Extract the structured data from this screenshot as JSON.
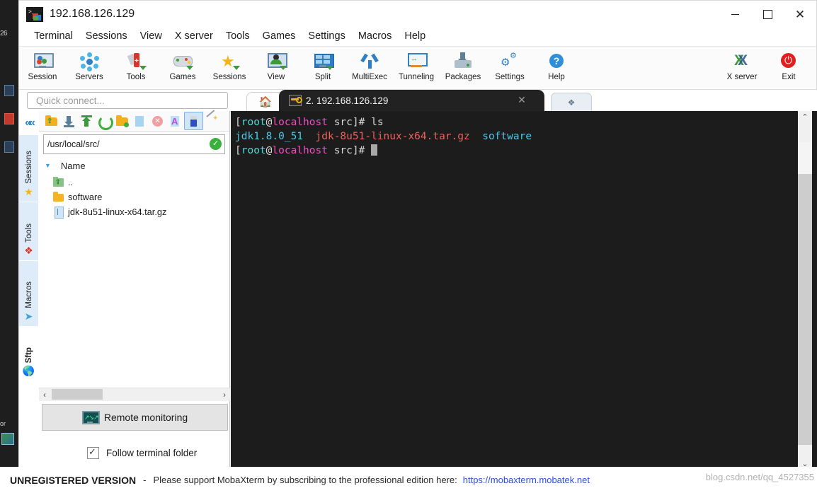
{
  "window": {
    "title": "192.168.126.129",
    "app_icon": "mobaxterm-icon",
    "minimize_label": "Minimize",
    "maximize_label": "Maximize",
    "close_label": "Close"
  },
  "background_label": "26",
  "background_tiny_label": "or",
  "menubar": [
    {
      "label": "Terminal"
    },
    {
      "label": "Sessions"
    },
    {
      "label": "View"
    },
    {
      "label": "X server"
    },
    {
      "label": "Tools"
    },
    {
      "label": "Games"
    },
    {
      "label": "Settings"
    },
    {
      "label": "Macros"
    },
    {
      "label": "Help"
    }
  ],
  "toolbar": {
    "items": [
      {
        "label": "Session",
        "icon": "session-monitor-icon"
      },
      {
        "label": "Servers",
        "icon": "servers-network-icon"
      },
      {
        "label": "Tools",
        "icon": "tools-knife-icon"
      },
      {
        "label": "Games",
        "icon": "games-gamepad-icon"
      },
      {
        "label": "Sessions",
        "icon": "sessions-star-icon"
      },
      {
        "label": "View",
        "icon": "view-user-monitor-icon"
      },
      {
        "label": "Split",
        "icon": "split-grid-icon"
      },
      {
        "label": "MultiExec",
        "icon": "multiexec-fork-icon"
      },
      {
        "label": "Tunneling",
        "icon": "tunneling-monitor-icon"
      },
      {
        "label": "Packages",
        "icon": "packages-download-icon"
      },
      {
        "label": "Settings",
        "icon": "settings-gear-icon"
      },
      {
        "label": "Help",
        "icon": "help-question-icon"
      }
    ],
    "right_items": [
      {
        "label": "X server",
        "icon": "xserver-x-icon"
      },
      {
        "label": "Exit",
        "icon": "exit-power-icon"
      }
    ]
  },
  "quick_connect": {
    "placeholder": "Quick connect...",
    "value": "",
    "clip_icon": "paperclip-icon"
  },
  "tabs": {
    "home_icon": "home-icon",
    "new_tab_label": "❖",
    "items": [
      {
        "label": "2. 192.168.126.129",
        "icon": "key-icon",
        "active": true,
        "close_label": "✕"
      }
    ]
  },
  "vertical_strip": {
    "collapse_label": "««",
    "tabs": [
      {
        "label": "Sessions",
        "icon": "star-icon",
        "glyph": "★",
        "color": "#f5b315",
        "active": false
      },
      {
        "label": "Tools",
        "icon": "knife-icon",
        "glyph": "⚘",
        "color": "#d8362a",
        "active": false
      },
      {
        "label": "Macros",
        "icon": "paper-plane-icon",
        "glyph": "➤",
        "color": "#3f9fd8",
        "active": false
      },
      {
        "label": "Sftp",
        "icon": "globe-icon",
        "glyph": "●",
        "color": "#f0a020",
        "active": true
      }
    ]
  },
  "sftp": {
    "toolbar_buttons": [
      {
        "name": "parent-folder-icon",
        "selected": false
      },
      {
        "name": "download-icon",
        "selected": false
      },
      {
        "name": "upload-icon",
        "selected": false
      },
      {
        "name": "refresh-icon",
        "selected": false
      },
      {
        "name": "new-folder-icon",
        "selected": false
      },
      {
        "name": "new-file-icon",
        "selected": false
      },
      {
        "name": "delete-icon",
        "selected": false
      },
      {
        "name": "text-editor-icon",
        "selected": false
      },
      {
        "name": "usb-drive-icon",
        "selected": true
      },
      {
        "name": "magic-wand-icon",
        "selected": false
      }
    ],
    "path": "/usr/local/src/",
    "path_ok_icon": "check-circle-icon",
    "column_header": "Name",
    "sort_caret": "▼",
    "files": [
      {
        "name": "..",
        "icon": "parent-dir-icon"
      },
      {
        "name": "software",
        "icon": "folder-icon"
      },
      {
        "name": "jdk-8u51-linux-x64.tar.gz",
        "icon": "file-icon"
      }
    ],
    "hscroll": {
      "left_arrow": "‹",
      "right_arrow": "›"
    },
    "remote_monitoring": {
      "label": "Remote monitoring",
      "icon": "monitor-graph-icon"
    },
    "follow_terminal": {
      "label": "Follow terminal folder",
      "checked": true
    }
  },
  "terminal": {
    "colors": {
      "background": "#1c1c1c",
      "user": "#4fd8d8",
      "host": "#f04fc4",
      "text": "#d8d8d8",
      "directory": "#4fc8e8",
      "archive": "#f0605c"
    },
    "lines": [
      {
        "type": "prompt_command",
        "bracket_open": "[",
        "user": "root",
        "at": "@",
        "host": "localhost",
        "path": " src",
        "bracket_close": "]# ",
        "command": "ls"
      },
      {
        "type": "output",
        "entries": [
          {
            "text": "jdk1.8.0_51",
            "kind": "directory"
          },
          {
            "text": "  ",
            "kind": "space"
          },
          {
            "text": "jdk-8u51-linux-x64.tar.gz",
            "kind": "archive"
          },
          {
            "text": "  ",
            "kind": "space"
          },
          {
            "text": "software",
            "kind": "directory"
          }
        ]
      },
      {
        "type": "prompt",
        "bracket_open": "[",
        "user": "root",
        "at": "@",
        "host": "localhost",
        "path": " src",
        "bracket_close": "]# ",
        "command": ""
      }
    ],
    "scrollbar": {
      "up_arrow": "⌃",
      "down_arrow": "⌄"
    }
  },
  "footer": {
    "unregistered": "UNREGISTERED VERSION",
    "separator": "-",
    "message": "Please support MobaXterm by subscribing to the professional edition here:",
    "link": "https://mobaxterm.mobatek.net",
    "watermark": "blog.csdn.net/qq_4527355"
  }
}
